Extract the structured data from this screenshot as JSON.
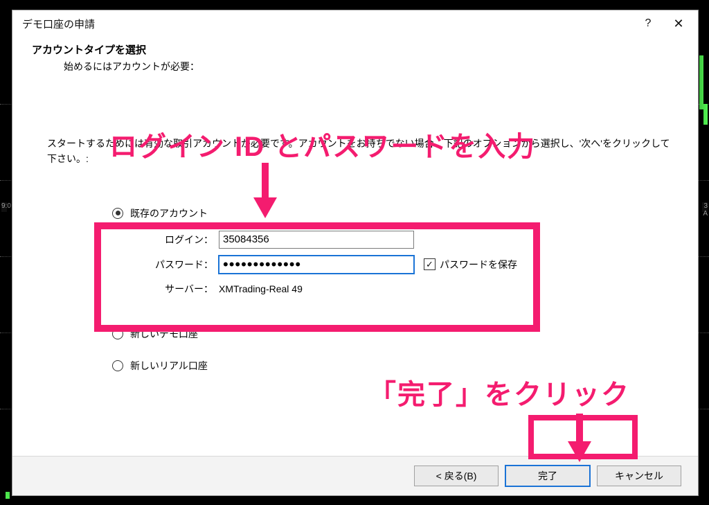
{
  "dialog": {
    "title": "デモ口座の申請",
    "heading": "アカウントタイプを選択",
    "subheading": "始めるにはアカウントが必要：",
    "instruction": "スタートするためには有効な取引アカウントが必要です。アカウントをお持ちでない場合、下記のオプションから選択し、'次へ'をクリックして下さい。:"
  },
  "options": {
    "existing": "既存のアカウント",
    "new_demo": "新しいデモ口座",
    "new_real": "新しいリアル口座"
  },
  "fields": {
    "login_label": "ログイン：",
    "login_value": "35084356",
    "password_label": "パスワード：",
    "password_value": "•••••••••••••",
    "save_password_label": "パスワードを保存",
    "server_label": "サーバー：",
    "server_value": "XMTrading-Real 49"
  },
  "buttons": {
    "back": "< 戻る(B)",
    "finish": "完了",
    "cancel": "キャンセル"
  },
  "annotations": {
    "line1": "ログイン ID とパスワードを入力",
    "line2": "「完了」をクリック"
  },
  "bg": {
    "time_left": "9:0",
    "time_right": "3 A"
  }
}
